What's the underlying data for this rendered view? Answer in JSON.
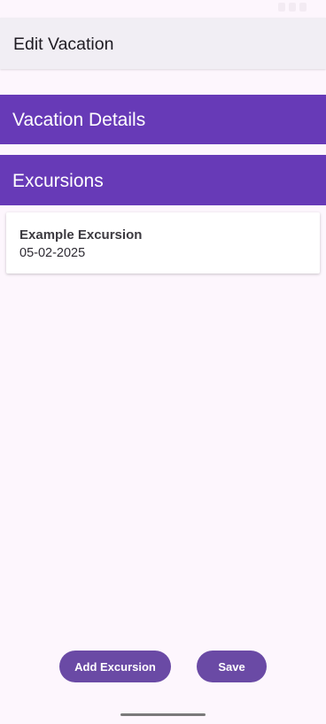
{
  "app_bar": {
    "title": "Edit Vacation"
  },
  "sections": {
    "vacation_details": "Vacation Details",
    "excursions": "Excursions"
  },
  "excursion_list": [
    {
      "name": "Example Excursion",
      "date": "05-02-2025"
    }
  ],
  "buttons": {
    "add_excursion": "Add Excursion",
    "save": "Save"
  },
  "colors": {
    "primary": "#673ab7",
    "button": "#6a4aa5",
    "background": "#fdf6fd",
    "app_bar": "#f1eef4"
  }
}
